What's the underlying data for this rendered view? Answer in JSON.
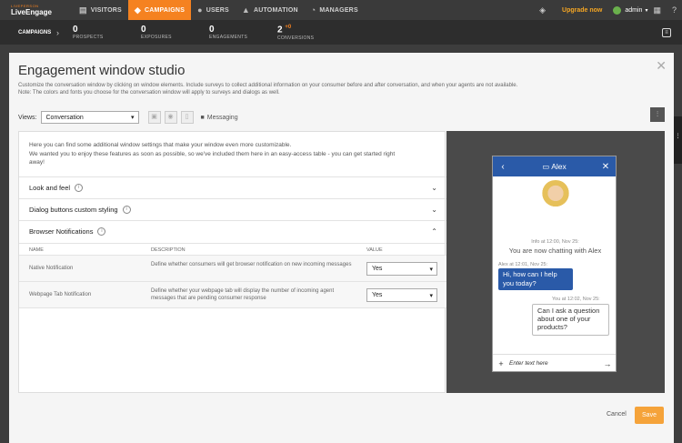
{
  "topbar": {
    "logo_sup": "LIVEPERSON",
    "logo_main": "LiveEngage",
    "nav": [
      {
        "label": "VISITORS",
        "icon": "chat-icon"
      },
      {
        "label": "CAMPAIGNS",
        "icon": "tag-icon"
      },
      {
        "label": "USERS",
        "icon": "user-icon"
      },
      {
        "label": "AUTOMATION",
        "icon": "automation-icon"
      },
      {
        "label": "MANAGERS",
        "icon": "gauge-icon"
      }
    ],
    "upgrade": "Upgrade now",
    "admin": "admin"
  },
  "subbar": {
    "label": "CAMPAIGNS",
    "stats": [
      {
        "value": "0",
        "label": "PROSPECTS"
      },
      {
        "value": "0",
        "label": "EXPOSURES"
      },
      {
        "value": "0",
        "label": "ENGAGEMENTS"
      },
      {
        "value": "2",
        "sup": "+0",
        "label": "CONVERSIONS"
      }
    ]
  },
  "modal": {
    "title": "Engagement window studio",
    "description": "Customize the conversation window by clicking on window elements. Include surveys to collect additional information on your consumer before and after conversation, and when your agents are not available.",
    "note": "Note: The colors and fonts you choose for the conversation window will apply to surveys and dialogs as well.",
    "views_label": "Views:",
    "views_value": "Conversation",
    "messaging_label": "Messaging",
    "intro_line1": "Here you can find some additional window settings that make your window even more customizable.",
    "intro_line2": "We wanted you to enjoy these features as soon as possible, so we've included them here in an easy-access table - you can get started right away!",
    "accordions": [
      {
        "label": "Look and feel"
      },
      {
        "label": "Dialog buttons custom styling"
      },
      {
        "label": "Browser Notifications"
      }
    ],
    "table": {
      "headers": [
        "NAME",
        "DESCRIPTION",
        "VALUE"
      ],
      "rows": [
        {
          "name": "Native Notification",
          "description": "Define whether consumers will get browser notification on new incoming messages",
          "value": "Yes"
        },
        {
          "name": "Webpage Tab Notification",
          "description": "Define whether your webpage tab will display the number of incoming agent messages that are pending consumer response",
          "value": "Yes"
        }
      ]
    },
    "cancel": "Cancel",
    "save": "Save"
  },
  "preview": {
    "agent_name": "Alex",
    "info_meta": "Info at 12:00, Nov 25:",
    "info_text": "You are now chatting with Alex",
    "agent_meta": "Alex at 12:01, Nov 25:",
    "agent_msg": "Hi, how can I help you today?",
    "user_meta": "You at 12:02, Nov 25:",
    "user_msg": "Can I ask a question about one of your products?",
    "input_placeholder": "Enter text here"
  }
}
